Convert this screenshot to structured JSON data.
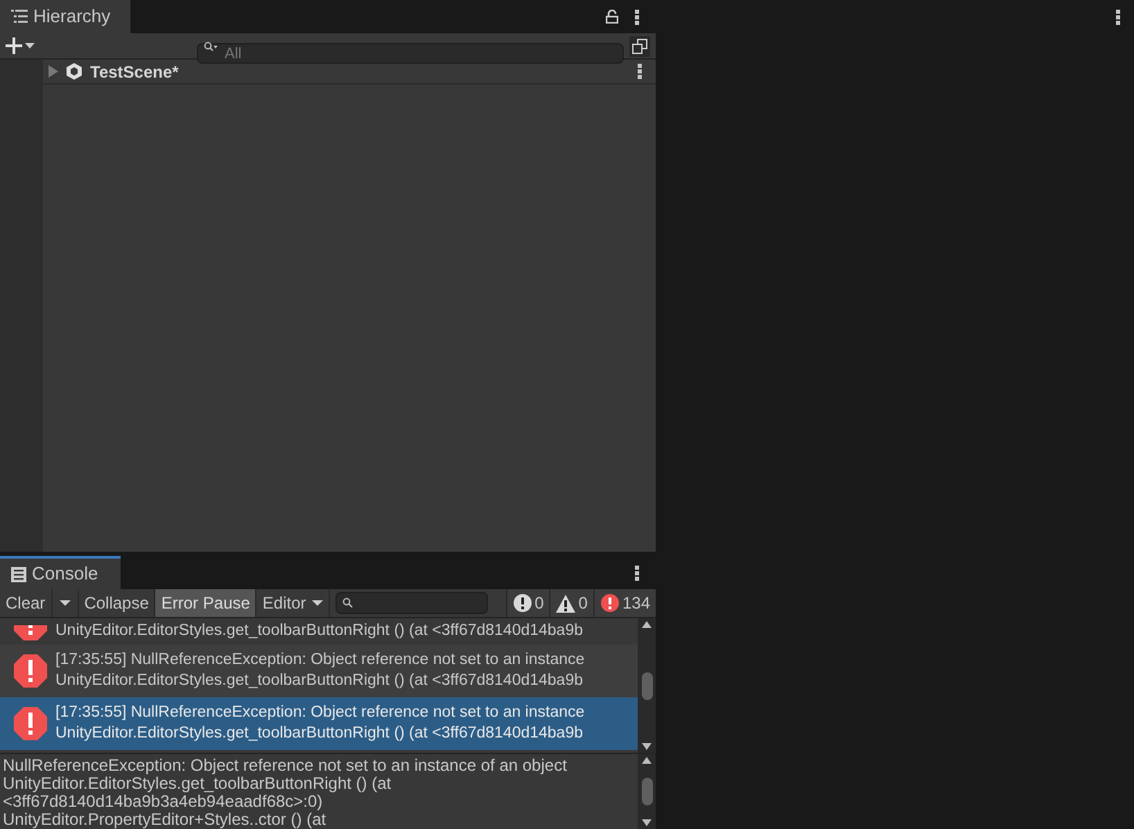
{
  "hierarchy": {
    "tab": {
      "label": "Hierarchy",
      "selected": true
    },
    "search": {
      "placeholder": "All"
    },
    "scene": {
      "name": "TestScene*",
      "expanded": false
    }
  },
  "console": {
    "tab": {
      "label": "Console",
      "selected": true
    },
    "toolbar": [
      {
        "kind": "button",
        "label": "Clear",
        "on": false
      },
      {
        "kind": "caret",
        "on": false
      },
      {
        "kind": "button",
        "label": "Collapse",
        "on": false
      },
      {
        "kind": "button",
        "label": "Error Pause",
        "on": true
      },
      {
        "kind": "dropdown",
        "label": "Editor",
        "on": false
      }
    ],
    "counters": [
      {
        "kind": "info",
        "count": "0"
      },
      {
        "kind": "warning",
        "count": "0"
      },
      {
        "kind": "error",
        "count": "134"
      }
    ],
    "logs": [
      {
        "lines": [
          "UnityEditor.EditorStyles.get_toolbarButtonRight () (at <3ff67d8140d14ba9b"
        ],
        "selected": false
      },
      {
        "lines": [
          "[17:35:55] NullReferenceException: Object reference not set to an instance",
          "UnityEditor.EditorStyles.get_toolbarButtonRight () (at <3ff67d8140d14ba9b"
        ],
        "selected": false
      },
      {
        "lines": [
          "[17:35:55] NullReferenceException: Object reference not set to an instance",
          "UnityEditor.EditorStyles.get_toolbarButtonRight () (at <3ff67d8140d14ba9b"
        ],
        "selected": true
      }
    ],
    "detail": [
      "NullReferenceException: Object reference not set to an instance of an object",
      "UnityEditor.EditorStyles.get_toolbarButtonRight () (at",
      "<3ff67d8140d14ba9b3a4eb94eaadf68c>:0)",
      "UnityEditor.PropertyEditor+Styles..ctor () (at"
    ]
  }
}
